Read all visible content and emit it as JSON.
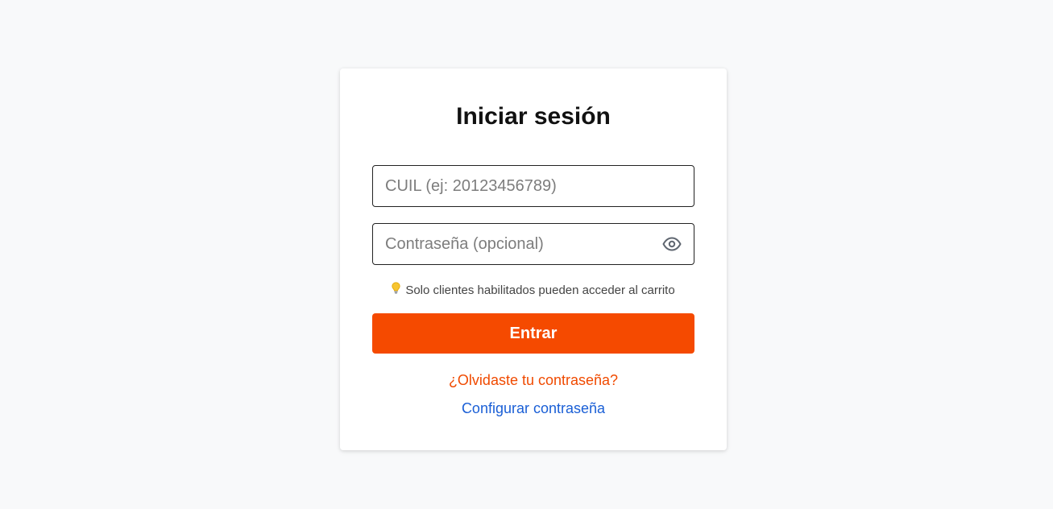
{
  "login": {
    "title": "Iniciar sesión",
    "cuil_placeholder": "CUIL (ej: 20123456789)",
    "cuil_value": "",
    "password_placeholder": "Contraseña (opcional)",
    "password_value": "",
    "password_toggle_icon": "eye-icon",
    "hint_icon": "lightbulb-icon",
    "hint_text": "Solo clientes habilitados pueden acceder al carrito",
    "submit_label": "Entrar",
    "forgot_password_link": "¿Olvidaste tu contraseña?",
    "configure_password_link": "Configurar contraseña"
  },
  "colors": {
    "page_background": "#f8f9fa",
    "card_background": "#ffffff",
    "primary_button": "#f54a00",
    "forgot_link": "#f04a00",
    "configure_link": "#1a5fd6"
  }
}
